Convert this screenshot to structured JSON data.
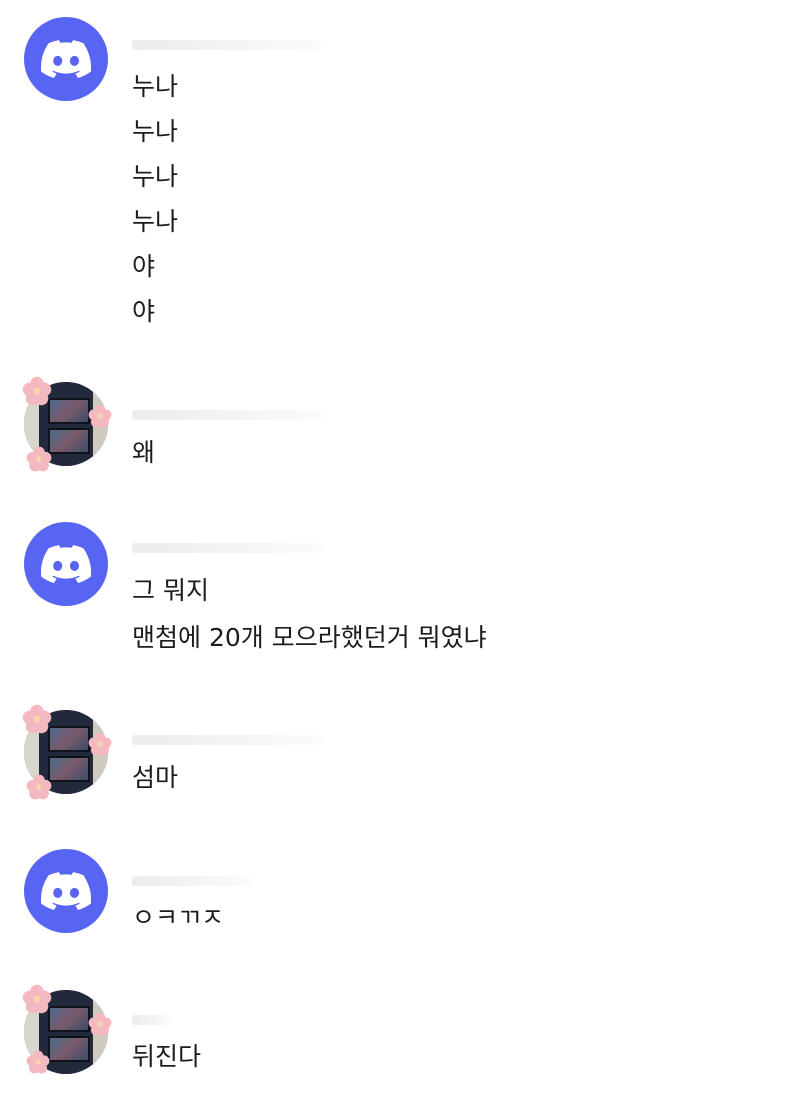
{
  "messages": [
    {
      "author": "discord-default",
      "lines": [
        "누나",
        "누나",
        "누나",
        "누나",
        "야",
        "야"
      ]
    },
    {
      "author": "blossom-photo",
      "lines": [
        "왜"
      ]
    },
    {
      "author": "discord-default",
      "lines": [
        "그 뭐지",
        "맨첨에 20개 모으라했던거 뭐였냐"
      ]
    },
    {
      "author": "blossom-photo",
      "lines": [
        "섬마"
      ]
    },
    {
      "author": "discord-default",
      "lines": [
        "ㅇㅋㄲㅈ"
      ]
    },
    {
      "author": "blossom-photo",
      "lines": [
        "뒤진다"
      ]
    }
  ],
  "colors": {
    "discord_blurple": "#5865f2",
    "text": "#1c1c20",
    "background": "#ffffff"
  },
  "icons": {
    "discord_avatar": "discord-logo-icon",
    "photo_avatar": "cherry-blossom-photo-avatar"
  }
}
